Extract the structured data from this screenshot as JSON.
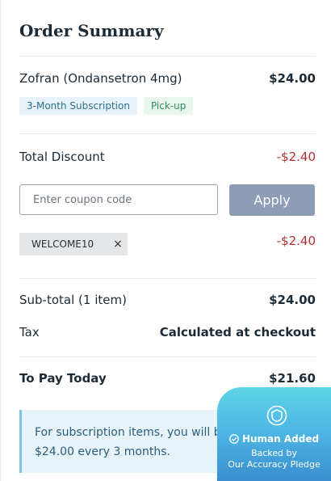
{
  "title": "Order Summary",
  "item": {
    "name": "Zofran (Ondansetron 4mg)",
    "price": "$24.00",
    "tags": [
      "3-Month Subscription",
      "Pick-up"
    ]
  },
  "discount": {
    "label": "Total Discount",
    "value": "-$2.40"
  },
  "coupon": {
    "placeholder": "Enter coupon code",
    "apply_label": "Apply",
    "code": "WELCOME10",
    "code_discount": "-$2.40",
    "remove_glyph": "×"
  },
  "totals": {
    "subtotal_label": "Sub-total (1 item)",
    "subtotal_value": "$24.00",
    "tax_label": "Tax",
    "tax_value": "Calculated at checkout",
    "pay_label": "To Pay Today",
    "pay_value": "$21.60"
  },
  "notice": {
    "line1": "For subscription items, you will be billed",
    "line2": "$24.00 every 3 months."
  },
  "badge": {
    "title": "Human Added",
    "line1": "Backed by",
    "line2": "Our Accuracy Pledge",
    "icon": "shield-icon"
  },
  "colors": {
    "discount_red": "#b3303a",
    "apply_button": "#8e9db5",
    "notice_bg": "#e6f4fa"
  }
}
